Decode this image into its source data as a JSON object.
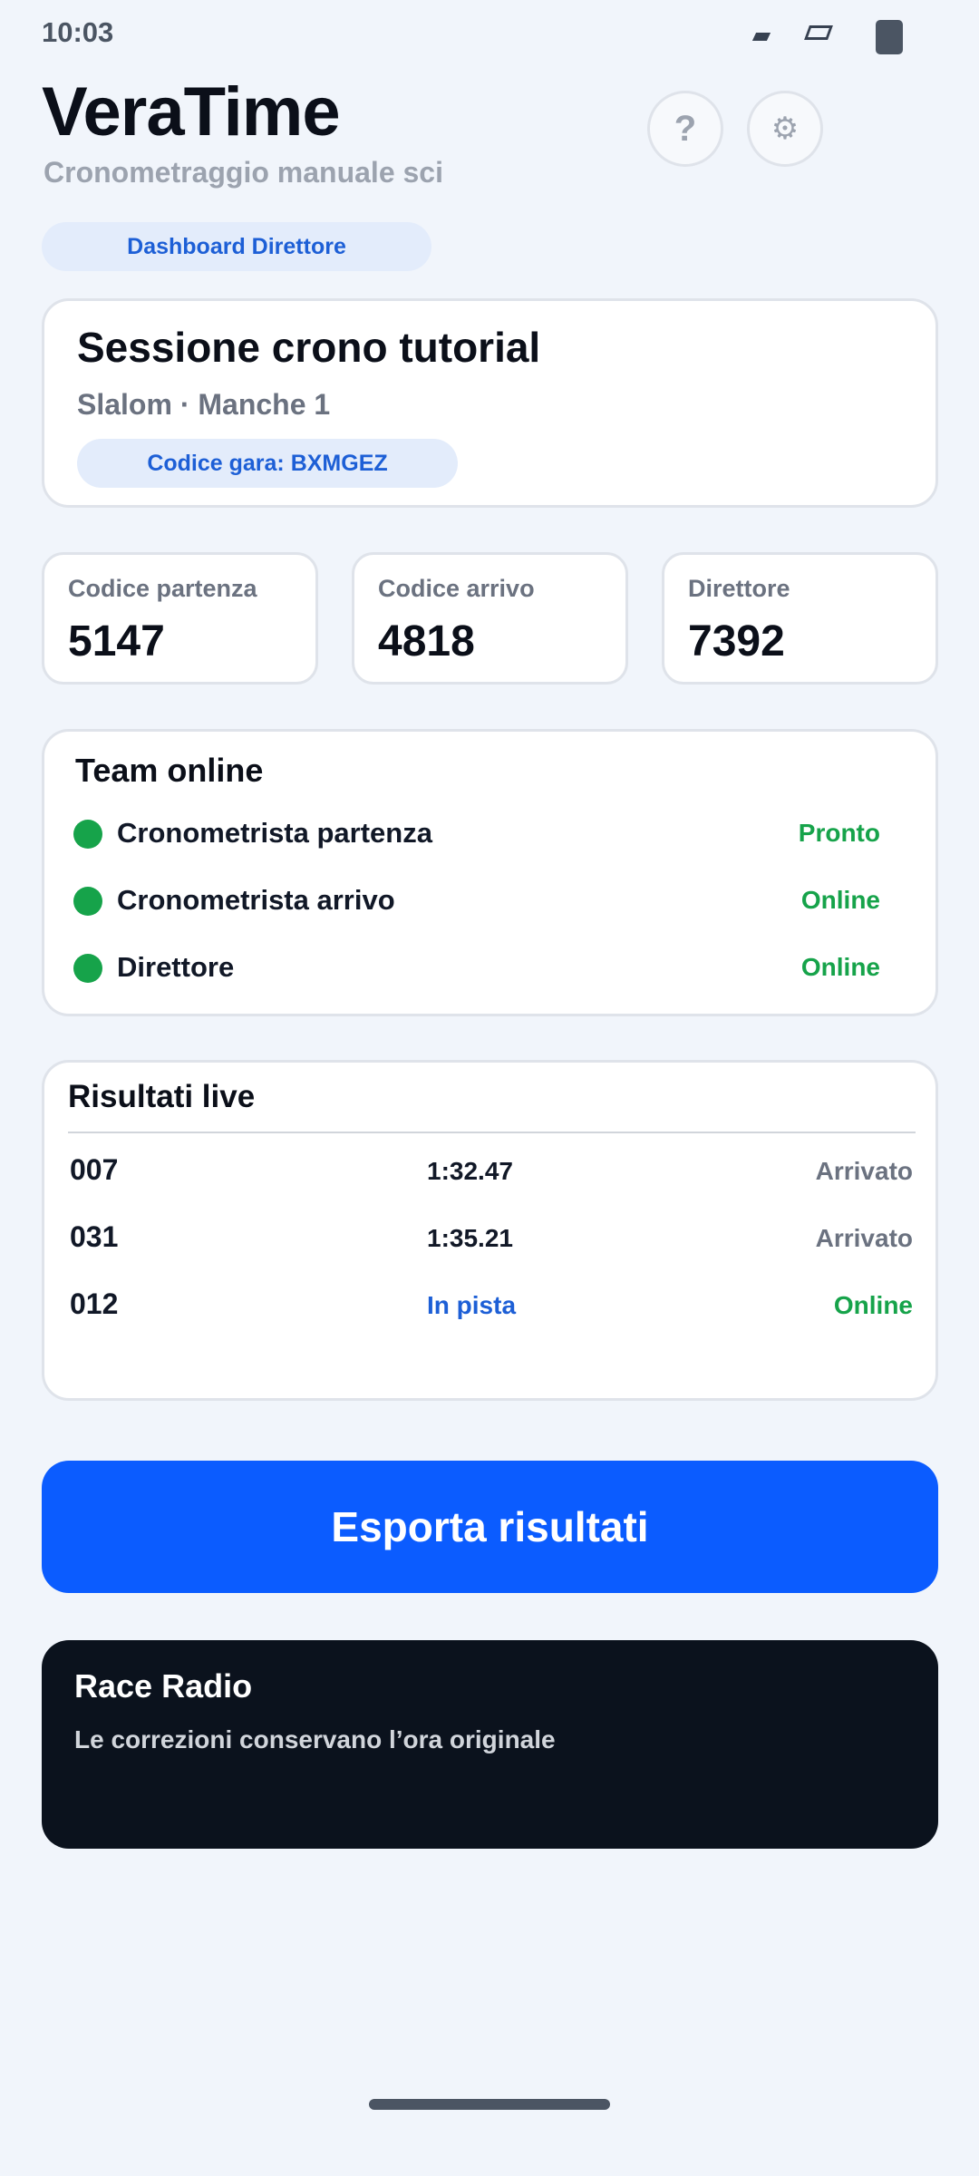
{
  "status_bar": {
    "time": "10:03"
  },
  "header": {
    "title": "VeraTime",
    "subtitle": "Cronometraggio manuale sci",
    "help_label": "?",
    "settings_label": "⚙",
    "dashboard_pill": "Dashboard Direttore"
  },
  "session": {
    "title": "Sessione crono tutorial",
    "subtitle": "Slalom · Manche 1",
    "race_code": "Codice gara: BXMGEZ"
  },
  "codes": [
    {
      "label": "Codice partenza",
      "value": "5147"
    },
    {
      "label": "Codice arrivo",
      "value": "4818"
    },
    {
      "label": "Direttore",
      "value": "7392"
    }
  ],
  "team": {
    "title": "Team online",
    "members": [
      {
        "name": "Cronometrista partenza",
        "status": "Pronto"
      },
      {
        "name": "Cronometrista arrivo",
        "status": "Online"
      },
      {
        "name": "Direttore",
        "status": "Online"
      }
    ],
    "status_color": "#16a34a"
  },
  "results": {
    "title": "Risultati live",
    "rows": [
      {
        "bib": "007",
        "time": "1:32.47",
        "status": "Arrivato"
      },
      {
        "bib": "031",
        "time": "1:35.21",
        "status": "Arrivato"
      },
      {
        "bib": "012",
        "time": "In pista",
        "status": "Online"
      }
    ]
  },
  "export_button": "Esporta risultati",
  "race_radio": {
    "title": "Race Radio",
    "message": "Le correzioni conservano l’ora originale"
  },
  "colors": {
    "accent": "#0b5cff",
    "online_green": "#16a34a",
    "radio_background": "#0b121d"
  }
}
